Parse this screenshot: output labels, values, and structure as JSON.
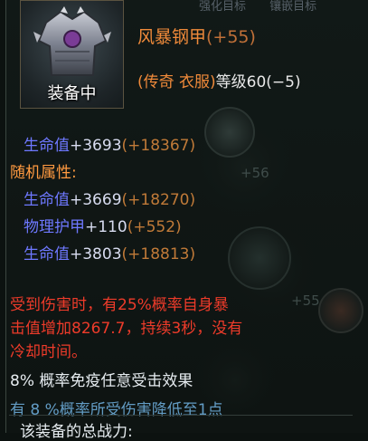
{
  "tabs": [
    "强化目标",
    "镶嵌目标"
  ],
  "item": {
    "icon": "armor-chest-icon",
    "equipped_label": "装备中",
    "name": "风暴钢甲",
    "enhance": "(+55)",
    "rarity_type": "(传奇 衣服)",
    "level": "等级60(−5)"
  },
  "base_stat": {
    "name": "生命值",
    "value": "+3693",
    "bonus": "(+18367)"
  },
  "random_heading": "随机属性:",
  "random_stats": [
    {
      "name": "生命值",
      "value": "+3669",
      "bonus": "(+18270)"
    },
    {
      "name": "物理护甲",
      "value": "+110",
      "bonus": "(+552)"
    },
    {
      "name": "生命值",
      "value": "+3803",
      "bonus": "(+18813)"
    }
  ],
  "ghost_numbers": [
    "+56",
    "+55"
  ],
  "special_effect": {
    "line1": "受到伤害时，有25%概率自身暴",
    "line2": "击值增加8267.7，持续3秒，没有",
    "line3": "冷却时间。"
  },
  "immunity": "8% 概率免疫任意受击效果",
  "partial_line": "有 8 %概率所受伤害降低至1点",
  "power_label": "该装备的总战力:"
}
